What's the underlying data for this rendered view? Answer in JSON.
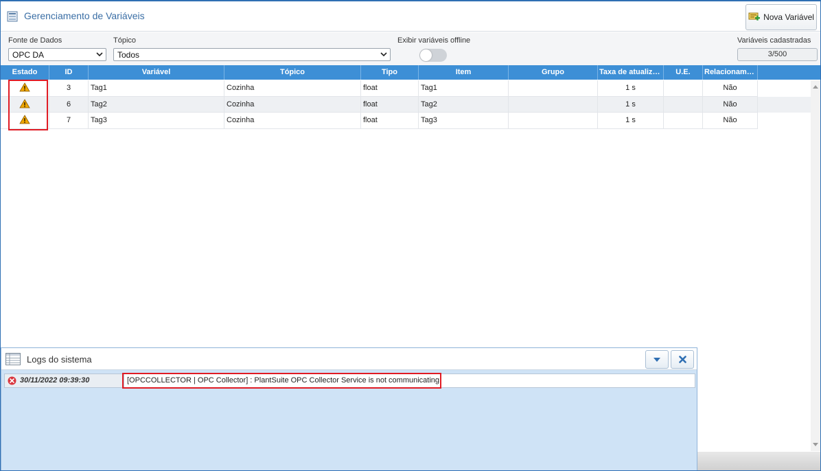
{
  "header": {
    "title": "Gerenciamento de Variáveis",
    "new_button_label": "Nova Variável"
  },
  "filters": {
    "data_source_label": "Fonte de Dados",
    "data_source_value": "OPC DA",
    "topic_label": "Tópico",
    "topic_value": "Todos",
    "offline_label": "Exibir variáveis offline",
    "offline_enabled": false,
    "registered_label": "Variáveis cadastradas",
    "registered_value": "3/500"
  },
  "grid": {
    "columns": [
      "Estado",
      "ID",
      "Variável",
      "Tópico",
      "Tipo",
      "Item",
      "Grupo",
      "Taxa de atualiza...",
      "U.E.",
      "Relacioname..."
    ],
    "rows": [
      {
        "estado": "warning-icon",
        "id": "3",
        "variavel": "Tag1",
        "topico": "Cozinha",
        "tipo": "float",
        "item": "Tag1",
        "grupo": "",
        "taxa": "1 s",
        "ue": "",
        "relacionamento": "Não"
      },
      {
        "estado": "warning-icon",
        "id": "6",
        "variavel": "Tag2",
        "topico": "Cozinha",
        "tipo": "float",
        "item": "Tag2",
        "grupo": "",
        "taxa": "1 s",
        "ue": "",
        "relacionamento": "Não"
      },
      {
        "estado": "warning-icon",
        "id": "7",
        "variavel": "Tag3",
        "topico": "Cozinha",
        "tipo": "float",
        "item": "Tag3",
        "grupo": "",
        "taxa": "1 s",
        "ue": "",
        "relacionamento": "Não"
      }
    ]
  },
  "logs": {
    "title": "Logs do sistema",
    "entries": [
      {
        "level": "error",
        "timestamp": "30/11/2022 09:39:30",
        "message": "[OPCCOLLECTOR | OPC Collector] : PlantSuite OPC Collector Service is not communicating!"
      }
    ]
  },
  "colors": {
    "accent": "#3d8fd6",
    "highlight": "#e01b24",
    "warning": "#f0a800",
    "error": "#d9363e"
  }
}
